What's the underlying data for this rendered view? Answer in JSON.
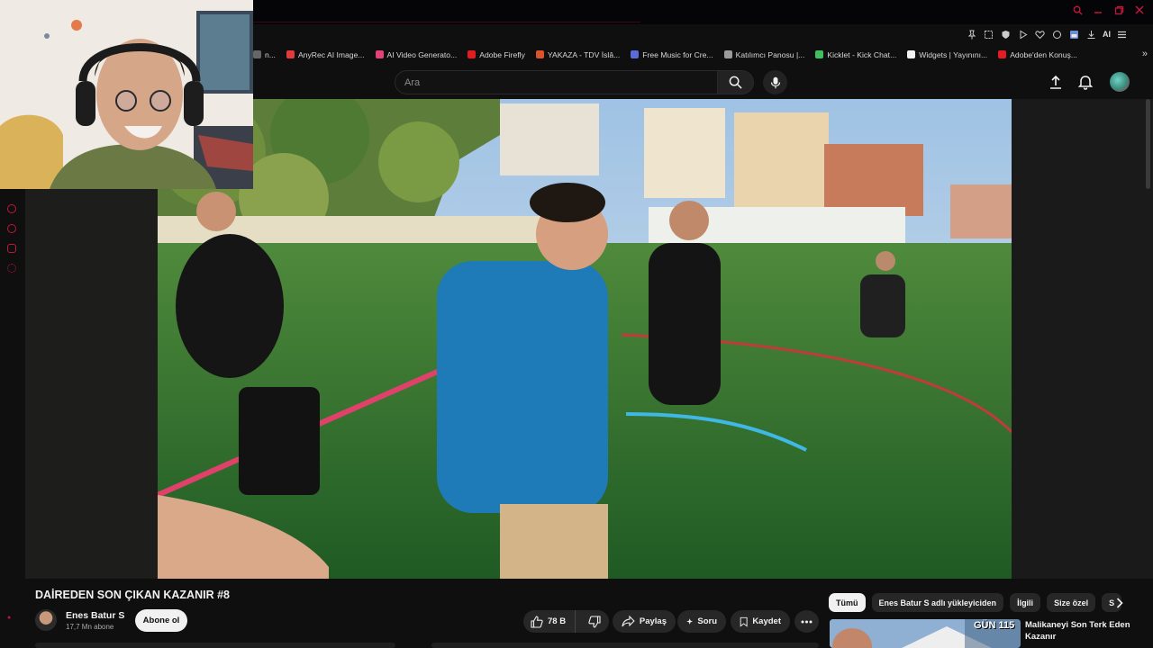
{
  "browser": {
    "bookmarks": [
      {
        "label": "n...",
        "color": "#666666"
      },
      {
        "label": "AnyRec AI Image...",
        "color": "#e23b3b"
      },
      {
        "label": "AI Video Generato...",
        "color": "#e4407a"
      },
      {
        "label": "Adobe Firefly",
        "color": "#e31b23"
      },
      {
        "label": "YAKAZA - TDV İslâ...",
        "color": "#d9532b"
      },
      {
        "label": "Free Music for Cre...",
        "color": "#5b6bd8"
      },
      {
        "label": "Katılımcı Panosu |...",
        "color": "#9a9a9a"
      },
      {
        "label": "Kicklet - Kick Chat...",
        "color": "#3fbf5f"
      },
      {
        "label": "Widgets | Yayınını...",
        "color": "#f1f1f1"
      },
      {
        "label": "Adobe'den Konuş...",
        "color": "#e31b23"
      }
    ],
    "ai_label": "AI"
  },
  "header": {
    "search_placeholder": "Ara"
  },
  "video": {
    "title": "DAİREDEN SON ÇIKAN KAZANIR #8",
    "channel_name": "Enes Batur S",
    "subscriber_count": "17,7 Mn abone",
    "subscribe_label": "Abone ol",
    "like_count": "78 B",
    "share_label": "Paylaş",
    "ask_label": "Soru",
    "save_label": "Kaydet"
  },
  "sidebar_right": {
    "chips": [
      "Tümü",
      "Enes Batur S adlı yükleyiciden",
      "İlgili",
      "Size özel",
      "S"
    ],
    "recommended": {
      "title": "Malikaneyi Son Terk Eden Kazanır",
      "thumb_text": "GÜN 115"
    }
  },
  "colors": {
    "accent_red": "#c0163c",
    "yt_bg": "#0f0f0f",
    "pill_bg": "#272727"
  }
}
